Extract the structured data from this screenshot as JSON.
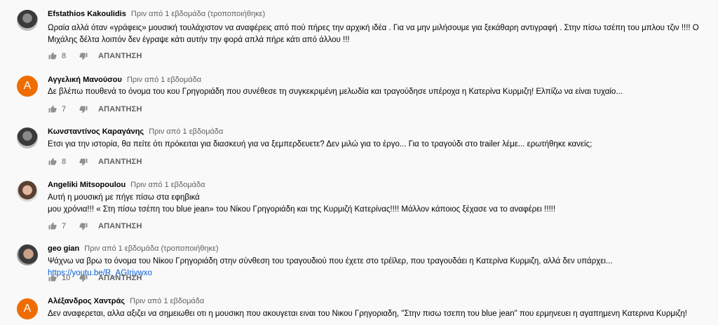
{
  "comments": [
    {
      "author": "Efstathios Kakoulidis",
      "time": "Πριν από 1 εβδομάδα (τροποποιήθηκε)",
      "lines": [
        "Ωραία αλλά όταν «γράφεις» μουσική τουλάχιστον να αναφέρεις από πού πήρες την αρχική ιδέα . Για να μην μιλήσουμε για ξεκάθαρη αντιγραφή . Στην πίσω τσέπη του μπλου τζιν !!!! Ο",
        "Μιχάλης δέλτα λοιπόν δεν έγραψε κάτι αυτήν την φορά απλά πήρε κάτι από άλλου !!!"
      ],
      "likes": "8",
      "reply_label": "ΑΠΑΝΤΗΣΗ",
      "avatar_icon": "user-photo"
    },
    {
      "author": "Αγγελική Μανούσου",
      "time": "Πριν από 1 εβδομάδα",
      "lines": [
        "Δε βλέπω πουθενά το όνομα του κου Γρηγοριάδη που συνέθεσε τη συγκεκριμένη μελωδία και τραγούδησε υπέροχα η Κατερίνα Κυρμιζη! Ελπίζω να είναι τυχαίο..."
      ],
      "likes": "7",
      "reply_label": "ΑΠΑΝΤΗΣΗ",
      "avatar_letter": "A"
    },
    {
      "author": "Κωνσταντίνος Καραγάνης",
      "time": "Πριν από 1 εβδομάδα",
      "lines": [
        "Ετσι για την ιστορία, θα πείτε ότι πρόκειται για διασκευή για να ξεμπερδευετε?  Δεν μιλώ για το έργο... Για το τραγούδι στο trailer λέμε... ερωτήθηκε κανείς;"
      ],
      "likes": "8",
      "reply_label": "ΑΠΑΝΤΗΣΗ",
      "avatar_icon": "user-photo"
    },
    {
      "author": "Angeliki Mitsopoulou",
      "time": "Πριν από 1 εβδομάδα",
      "lines": [
        "Αυτή η μουσική με πήγε πίσω στα εφηβικά",
        "μου χρόνια!!! « Στη πίσω τσέπη του blue jean» του Νίκου Γρηγοριάδη και της Κυρμιζή Κατερίνας!!!! Μάλλον κάποιος ξέχασε να το αναφέρει !!!!!"
      ],
      "likes": "7",
      "reply_label": "ΑΠΑΝΤΗΣΗ",
      "avatar_icon": "user-photo"
    },
    {
      "author": "geo gian",
      "time": "Πριν από 1 εβδομάδα (τροποποιήθηκε)",
      "lines": [
        "Ψάχνω να βρω το όνομα του Νίκου Γρηγοριάδη στην σύνθεση του τραγουδιού που έχετε στο τρέϊλερ, που τραγουδάει η Κατερίνα Κυρμιζη, αλλά δεν υπάρχει..."
      ],
      "link": "https://youtu.be/R_AGIriywxo",
      "likes": "10",
      "reply_label": "ΑΠΑΝΤΗΣΗ",
      "avatar_icon": "user-photo"
    },
    {
      "author": "Αλέξανδρος Χαντράς",
      "time": "Πριν από 1 εβδομάδα",
      "lines": [
        "Δεν αναφερεται, αλλα αξιζει να σημειωθει οτι η μουσικη που ακουγεται ειναι του Νικου Γρηγοριαδη, \"Στην πισω τσεπη του blue jean\" που ερμηνευει η αγαπημενη Κατερινα Κυρμιζη!"
      ],
      "avatar_letter": "A"
    }
  ],
  "colors": {
    "author": "#030303",
    "meta": "#606060",
    "link": "#065fd4",
    "avatar_letter_bg": "#ef6c00"
  },
  "icons": {
    "like": "thumbs-up-icon",
    "dislike": "thumbs-down-icon"
  }
}
